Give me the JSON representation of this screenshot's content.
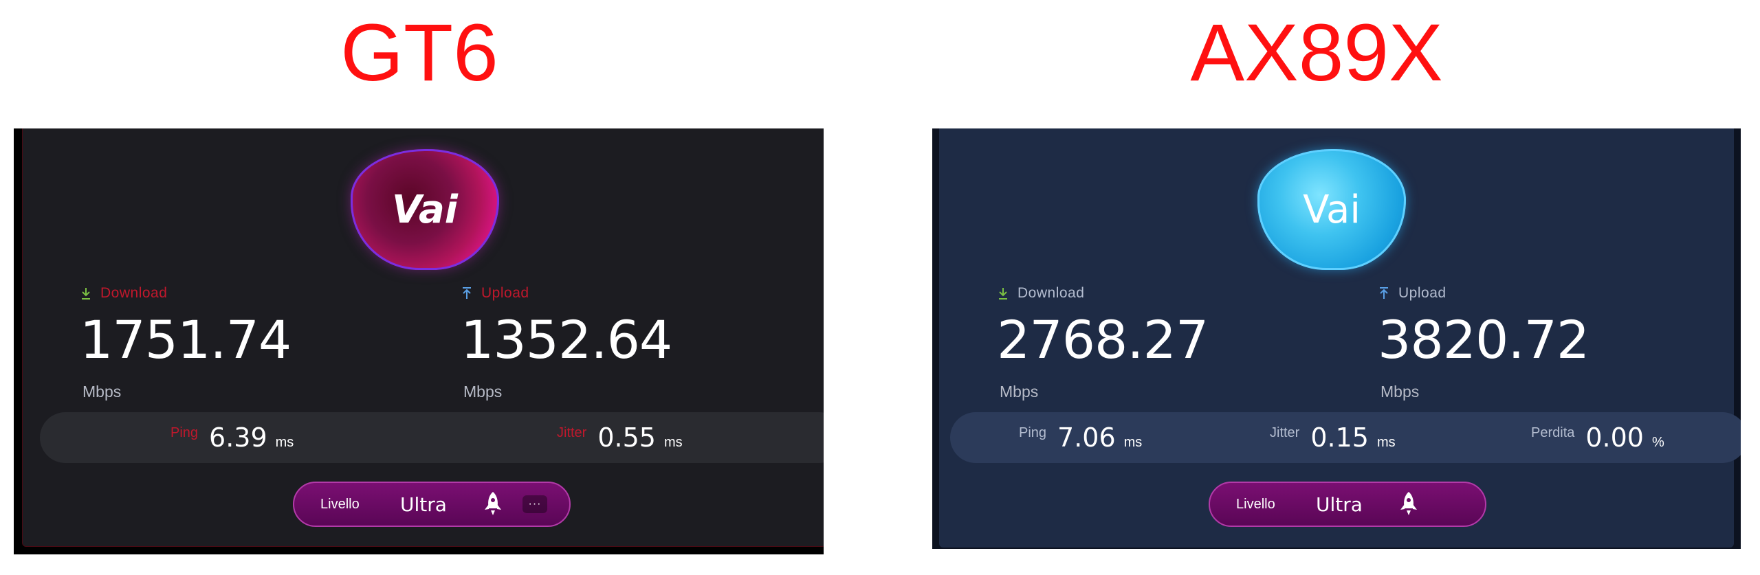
{
  "titles": {
    "left": "GT6",
    "right": "AX89X"
  },
  "colors": {
    "title": "#ff1010",
    "gt6_accent": "#c0182c",
    "ax_label": "#b4bdd0",
    "level_pill": "#6b0a66",
    "download_icon": "#7bc043",
    "upload_icon": "#5aa0e6"
  },
  "panels": [
    {
      "go_label": "Vai",
      "download": {
        "label": "Download",
        "value": "1751.74",
        "unit": "Mbps",
        "icon": "download-arrow-icon"
      },
      "upload": {
        "label": "Upload",
        "value": "1352.64",
        "unit": "Mbps",
        "icon": "upload-arrow-icon"
      },
      "ping": {
        "label": "Ping",
        "value": "6.39",
        "unit": "ms"
      },
      "jitter": {
        "label": "Jitter",
        "value": "0.55",
        "unit": "ms"
      },
      "level": {
        "label": "Livello",
        "value": "Ultra",
        "icon": "rocket-icon",
        "more": "···"
      }
    },
    {
      "go_label": "Vai",
      "download": {
        "label": "Download",
        "value": "2768.27",
        "unit": "Mbps",
        "icon": "download-arrow-icon"
      },
      "upload": {
        "label": "Upload",
        "value": "3820.72",
        "unit": "Mbps",
        "icon": "upload-arrow-icon"
      },
      "ping": {
        "label": "Ping",
        "value": "7.06",
        "unit": "ms"
      },
      "jitter": {
        "label": "Jitter",
        "value": "0.15",
        "unit": "ms"
      },
      "loss": {
        "label": "Perdita",
        "value": "0.00",
        "unit": "%"
      },
      "level": {
        "label": "Livello",
        "value": "Ultra",
        "icon": "rocket-icon"
      }
    }
  ]
}
